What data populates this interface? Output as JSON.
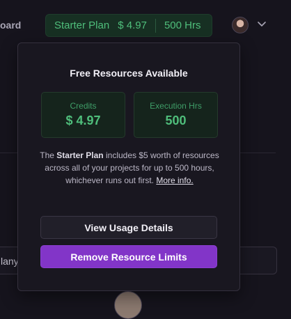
{
  "topnav": {
    "fragment_text": "oard"
  },
  "plan_pill": {
    "plan_name": "Starter Plan",
    "price": "$ 4.97",
    "hours": "500 Hrs"
  },
  "popover": {
    "title": "Free Resources Available",
    "credits": {
      "label": "Credits",
      "value": "$ 4.97"
    },
    "execution": {
      "label": "Execution Hrs",
      "value": "500"
    },
    "description": {
      "prefix": "The ",
      "plan": "Starter Plan",
      "middle": " includes $5 worth of resources across all of your projects for up to 500 hours, whichever runs out first. ",
      "link": "More info."
    },
    "view_usage_label": "View Usage Details",
    "remove_limits_label": "Remove Resource Limits"
  },
  "background": {
    "input_fragment_text": "lany"
  },
  "colors": {
    "accent_green": "#4fbe7b",
    "accent_purple": "#8235c8",
    "background": "#16141d",
    "surface": "#191720"
  },
  "icons": {
    "avatar": "user-avatar",
    "chevron": "chevron-down-icon"
  }
}
